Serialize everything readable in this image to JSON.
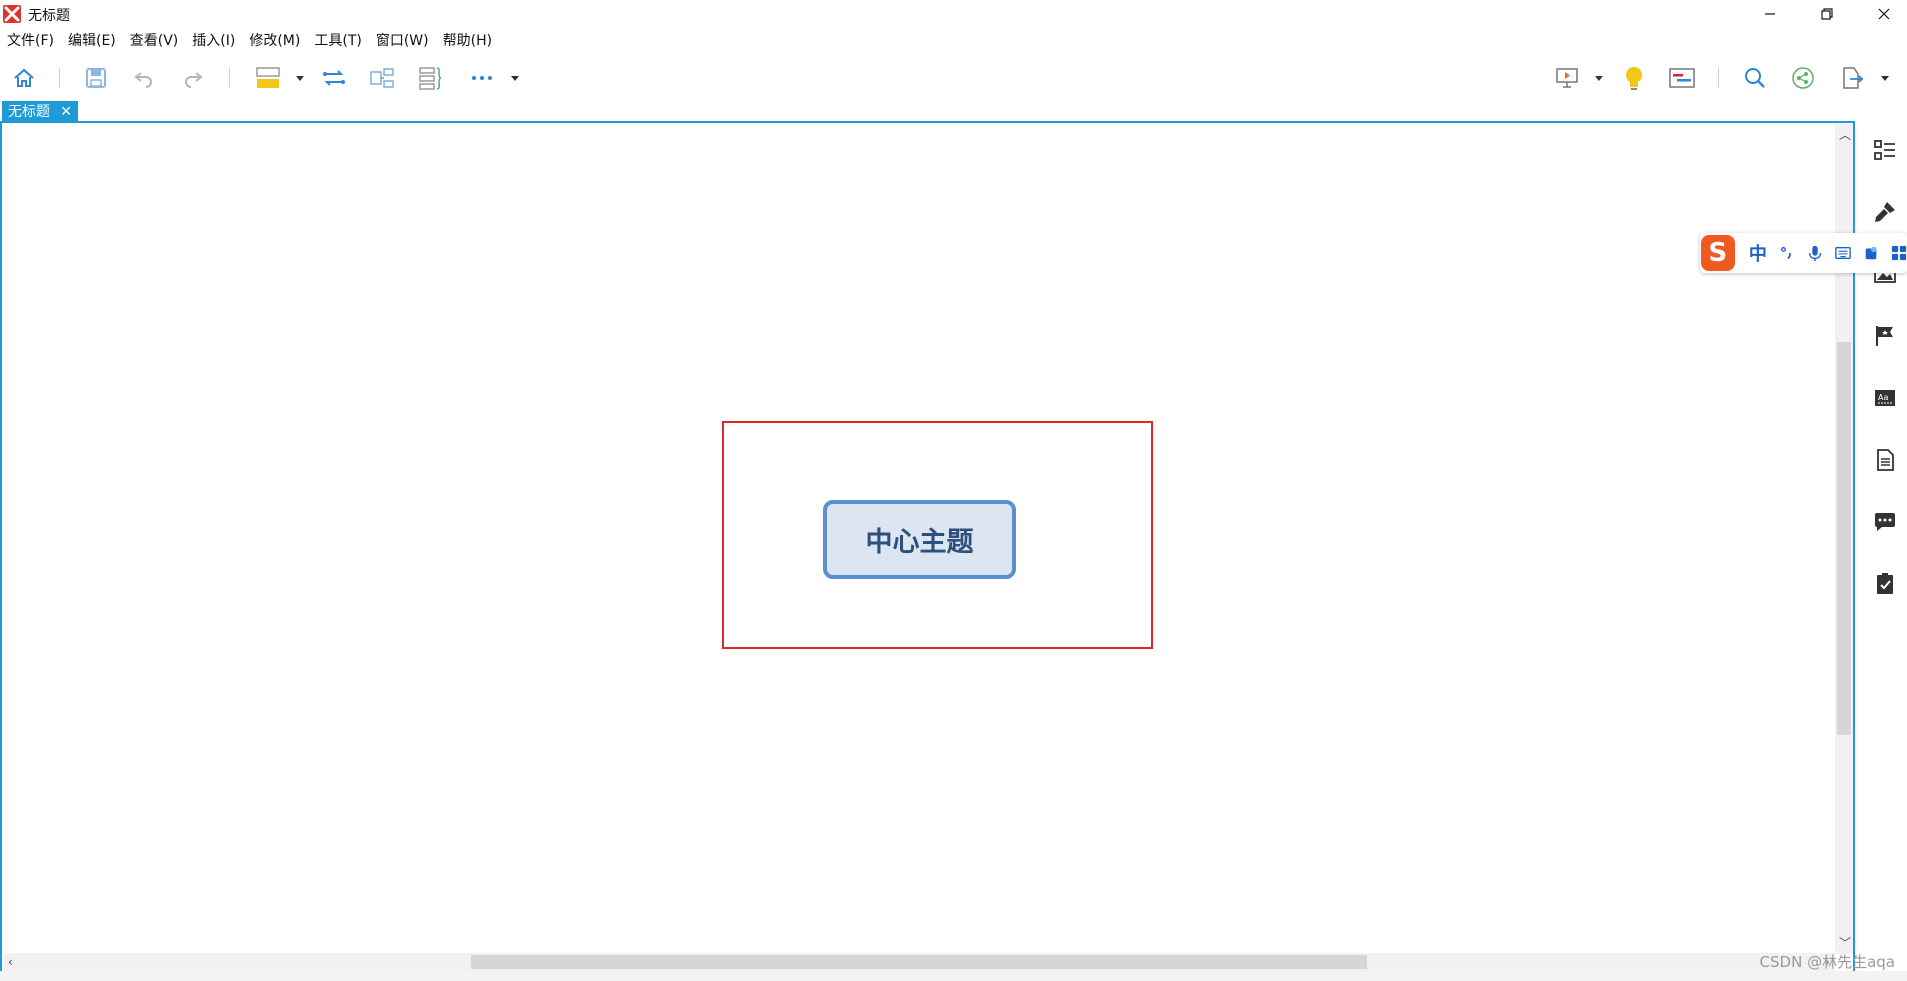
{
  "window": {
    "title": "无标题",
    "controls": {
      "minimize": "minimize",
      "maximize": "restore",
      "close": "close"
    }
  },
  "menu": [
    "文件(F)",
    "编辑(E)",
    "查看(V)",
    "插入(I)",
    "修改(M)",
    "工具(T)",
    "窗口(W)",
    "帮助(H)"
  ],
  "toolbar": {
    "left_icons": [
      "home-icon",
      "save-icon",
      "undo-icon",
      "redo-icon",
      "topic-icon",
      "relationship-icon",
      "summary-icon",
      "boundary-icon",
      "more-icon"
    ],
    "right_icons": [
      "presentation-icon",
      "idea-icon",
      "gantt-icon",
      "search-icon",
      "share-icon",
      "export-icon"
    ]
  },
  "tabs": [
    {
      "label": "无标题",
      "active": true
    }
  ],
  "canvas": {
    "central_topic": "中心主题",
    "topic_fill": "#dce6f2",
    "topic_border": "#5b8fd0",
    "selection_color": "#e3262b"
  },
  "right_sidebar": [
    "outline-icon",
    "format-icon",
    "image-icon",
    "marker-icon",
    "text-style-icon",
    "notes-icon",
    "comments-icon",
    "task-icon"
  ],
  "ime": {
    "logo": "S",
    "language": "中",
    "icons": [
      "punctuation-icon",
      "microphone-icon",
      "keyboard-icon",
      "skin-icon",
      "toolbox-icon"
    ]
  },
  "watermark": "CSDN @林先生aqa",
  "colors": {
    "accent": "#1e9ad6"
  }
}
